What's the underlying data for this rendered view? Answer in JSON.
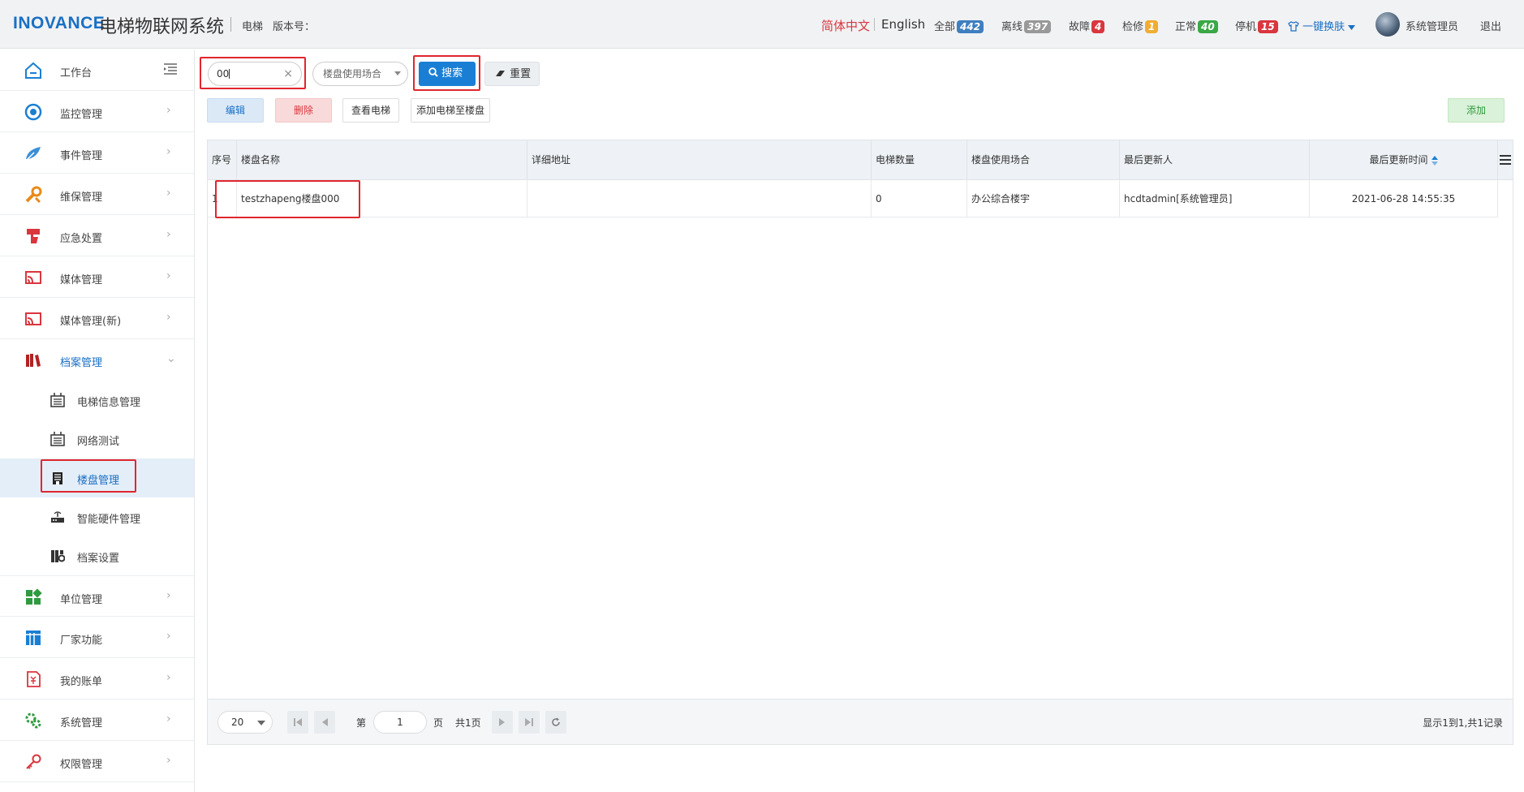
{
  "header": {
    "logo": "INOVANCE",
    "title": "电梯物联网系统",
    "elevator_label": "电梯",
    "version_label": "版本号：",
    "lang_cn": "简体中文",
    "lang_en": "English",
    "stats": [
      {
        "label": "全部",
        "count": "442",
        "color": "#3f7fbf"
      },
      {
        "label": "离线",
        "count": "397",
        "color": "#999999"
      },
      {
        "label": "故障",
        "count": "4",
        "color": "#d9363e"
      },
      {
        "label": "检修",
        "count": "1",
        "color": "#f0ad30"
      },
      {
        "label": "正常",
        "count": "40",
        "color": "#3aa845"
      },
      {
        "label": "停机",
        "count": "15",
        "color": "#d9363e"
      }
    ],
    "skin_label": "一键换肤",
    "user_name": "系统管理员",
    "logout": "退出"
  },
  "sidebar": {
    "workbench": "工作台",
    "items": [
      {
        "label": "监控管理",
        "icon": "monitor-icon"
      },
      {
        "label": "事件管理",
        "icon": "event-icon"
      },
      {
        "label": "维保管理",
        "icon": "maintenance-icon"
      },
      {
        "label": "应急处置",
        "icon": "emergency-icon"
      },
      {
        "label": "媒体管理",
        "icon": "media-icon"
      },
      {
        "label": "媒体管理(新)",
        "icon": "media-new-icon"
      },
      {
        "label": "档案管理",
        "icon": "archive-icon"
      },
      {
        "label": "单位管理",
        "icon": "unit-icon"
      },
      {
        "label": "厂家功能",
        "icon": "factory-icon"
      },
      {
        "label": "我的账单",
        "icon": "bill-icon"
      },
      {
        "label": "系统管理",
        "icon": "system-icon"
      },
      {
        "label": "权限管理",
        "icon": "permission-icon"
      }
    ],
    "sub_items": [
      {
        "label": "电梯信息管理"
      },
      {
        "label": "网络测试"
      },
      {
        "label": "楼盘管理"
      },
      {
        "label": "智能硬件管理"
      },
      {
        "label": "档案设置"
      }
    ]
  },
  "toolbar": {
    "search_value": "00",
    "select_placeholder": "楼盘使用场合",
    "search_btn": "搜索",
    "reset_btn": "重置",
    "edit_btn": "编辑",
    "delete_btn": "删除",
    "view_btn": "查看电梯",
    "add_to_btn": "添加电梯至楼盘",
    "add_btn": "添加"
  },
  "table": {
    "columns": [
      "序号",
      "楼盘名称",
      "详细地址",
      "电梯数量",
      "楼盘使用场合",
      "最后更新人",
      "最后更新时间"
    ],
    "rows": [
      [
        "1",
        "testzhapeng楼盘000",
        "",
        "0",
        "办公综合楼宇",
        "hcdtadmin[系统管理员]",
        "2021-06-28 14:55:35"
      ]
    ]
  },
  "pager": {
    "page_size": "20",
    "page_prefix": "第",
    "page_value": "1",
    "page_suffix": "页",
    "total_pages": "共1页",
    "info": "显示1到1,共1记录"
  }
}
